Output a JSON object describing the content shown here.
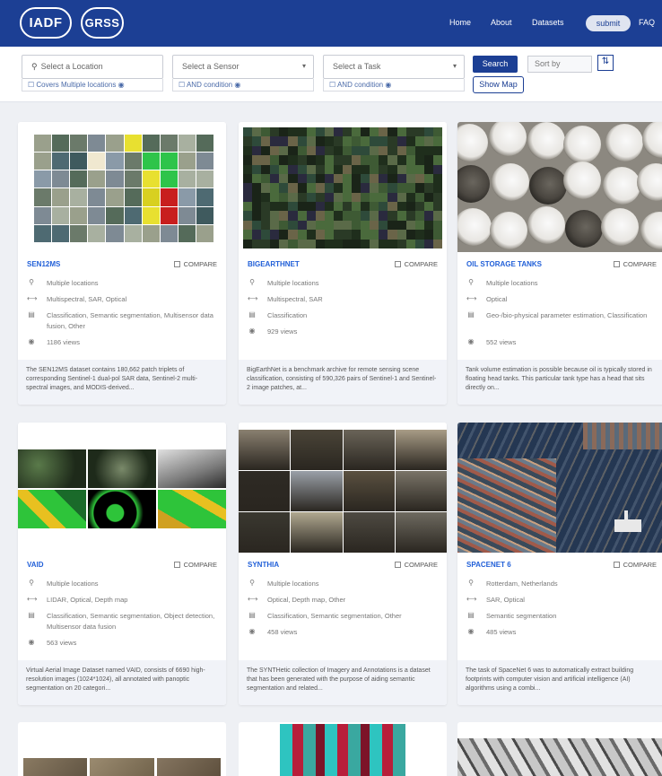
{
  "nav": {
    "logo_left": "IADF",
    "logo_right": "GRSS",
    "links": [
      "Home",
      "About",
      "Datasets"
    ],
    "submit": "submit",
    "faq": "FAQ"
  },
  "filters": {
    "location_placeholder": "Select a Location",
    "location_sub": "Covers Multiple locations",
    "sensor_placeholder": "Select a Sensor",
    "sensor_sub": "AND condition",
    "task_placeholder": "Select a Task",
    "task_sub": "AND condition",
    "search": "Search",
    "sort_by": "Sort by",
    "show_map": "Show Map"
  },
  "compare_label": "COMPARE",
  "cards": [
    {
      "title": "SEN12MS",
      "location": "Multiple locations",
      "sensor": "Multispectral, SAR, Optical",
      "task": "Classification, Semantic segmentation, Multisensor data fusion, Other",
      "views": "1186 views",
      "desc": "The SEN12MS dataset contains 180,662 patch triplets of corresponding Sentinel-1 dual-pol SAR data, Sentinel-2 multi-spectral images, and MODIS-derived..."
    },
    {
      "title": "BIGEARTHNET",
      "location": "Multiple locations",
      "sensor": "Multispectral, SAR",
      "task": "Classification",
      "views": "929 views",
      "desc": "BigEarthNet is a benchmark archive for remote sensing scene classification, consisting of 590,326 pairs of Sentinel-1 and Sentinel-2 image patches, at..."
    },
    {
      "title": "OIL STORAGE TANKS",
      "location": "Multiple locations",
      "sensor": "Optical",
      "task": "Geo-/bio-physical parameter estimation, Classification",
      "views": "552 views",
      "desc": "Tank volume estimation is possible because oil is typically stored in floating head tanks. This particular tank type has a head that sits directly on..."
    },
    {
      "title": "VAID",
      "location": "Multiple locations",
      "sensor": "LIDAR, Optical, Depth map",
      "task": "Classification, Semantic segmentation, Object detection, Multisensor data fusion",
      "views": "563 views",
      "desc": "Virtual Aerial Image Dataset named VAID, consists of 6690 high-resolution images (1024*1024), all annotated with panoptic segmentation on 20 categori..."
    },
    {
      "title": "SYNTHIA",
      "location": "Multiple locations",
      "sensor": "Optical, Depth map, Other",
      "task": "Classification, Semantic segmentation, Other",
      "views": "458 views",
      "desc": "The SYNTHetic collection of Imagery and Annotations is a dataset that has been generated with the purpose of aiding semantic segmentation and related..."
    },
    {
      "title": "SPACENET 6",
      "location": "Rotterdam, Netherlands",
      "sensor": "SAR, Optical",
      "task": "Semantic segmentation",
      "views": "485 views",
      "desc": "The task of SpaceNet 6 was to automatically extract building footprints with computer vision and artificial intelligence (AI) algorithms using a combi..."
    }
  ],
  "colors": {
    "primary": "#1c3f94",
    "title_blue": "#2260d8",
    "background": "#eef0f4"
  }
}
